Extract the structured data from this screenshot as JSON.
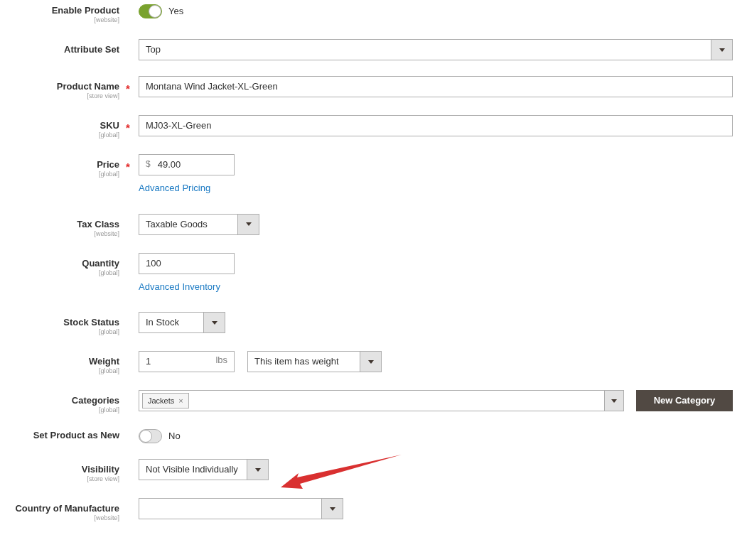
{
  "fields": [
    {
      "kind": "toggle",
      "label": "Enable Product",
      "scope": "[website]",
      "on": true,
      "value": "Yes"
    },
    {
      "kind": "select",
      "label": "Attribute Set",
      "value": "Top"
    },
    {
      "kind": "text",
      "label": "Product Name",
      "scope": "[store view]",
      "required_mark": "*",
      "value": "Montana Wind Jacket-XL-Green"
    },
    {
      "kind": "text",
      "label": "SKU",
      "scope": "[global]",
      "required_mark": "*",
      "value": "MJ03-XL-Green"
    },
    {
      "kind": "price",
      "label": "Price",
      "scope": "[global]",
      "required_mark": "*",
      "prefix": "$",
      "value": "49.00",
      "link": "Advanced Pricing"
    },
    {
      "kind": "select",
      "label": "Tax Class",
      "scope": "[website]",
      "value": "Taxable Goods"
    },
    {
      "kind": "text",
      "label": "Quantity",
      "scope": "[global]",
      "value": "100",
      "link": "Advanced Inventory"
    },
    {
      "kind": "select",
      "label": "Stock Status",
      "scope": "[global]",
      "value": "In Stock"
    },
    {
      "kind": "weight",
      "label": "Weight",
      "scope": "[global]",
      "value": "1",
      "unit": "lbs",
      "select_value": "This item has weight"
    },
    {
      "kind": "categories",
      "label": "Categories",
      "scope": "[global]",
      "tags": [
        "Jackets"
      ],
      "remove": "×",
      "button": "New Category"
    },
    {
      "kind": "toggle",
      "label": "Set Product as New",
      "on": false,
      "value": "No"
    },
    {
      "kind": "select",
      "label": "Visibility",
      "scope": "[store view]",
      "value": "Not Visible Individually"
    },
    {
      "kind": "select",
      "label": "Country of Manufacture",
      "scope": "[website]"
    }
  ]
}
